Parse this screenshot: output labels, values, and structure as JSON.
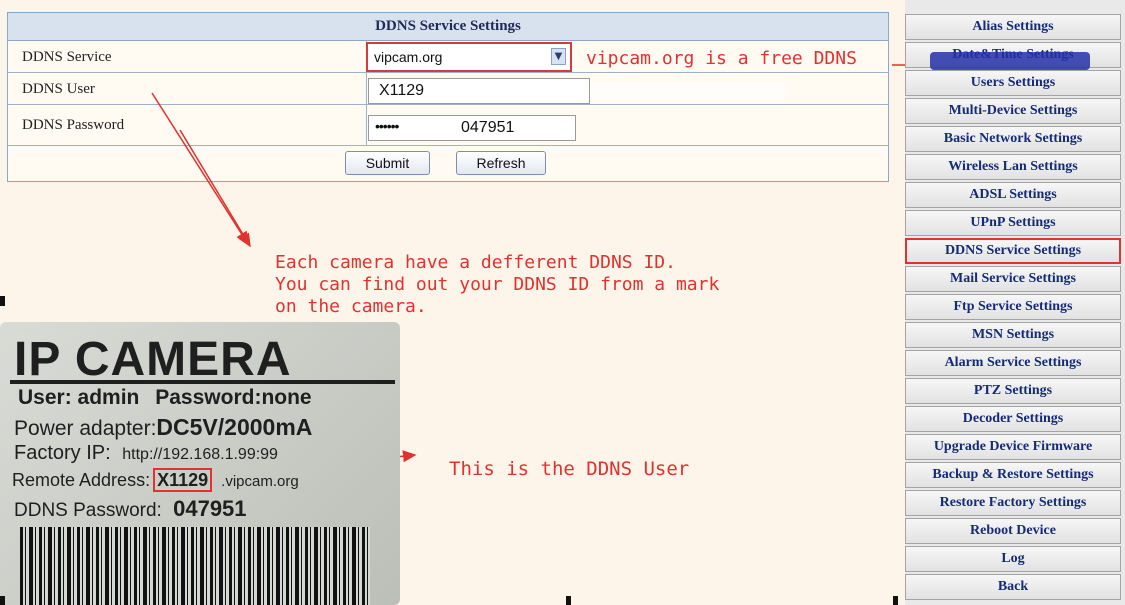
{
  "form": {
    "title": "DDNS Service Settings",
    "rows": [
      {
        "label": "DDNS Service"
      },
      {
        "label": "DDNS User"
      },
      {
        "label": "DDNS Password"
      }
    ],
    "service_value": "vipcam.org",
    "user_value": "X1129",
    "password_mask": "••••••",
    "password_value": "047951",
    "submit_label": "Submit",
    "refresh_label": "Refresh"
  },
  "annotations": {
    "service_note": "vipcam.org is a free DDNS",
    "id_note": "Each camera have a defferent DDNS ID.\nYou can find out your DDNS ID from a mark\non the camera.",
    "user_note": "This is the DDNS User"
  },
  "sticker": {
    "title": "IP CAMERA",
    "user_label": "User:",
    "user_value": "admin",
    "password_label": "Password:",
    "password_value": "none",
    "power_label": "Power adapter:",
    "power_value": "DC5V/2000mA",
    "factory_label": "Factory IP:",
    "factory_value": "http://192.168.1.99:99",
    "remote_label": "Remote Address:",
    "remote_id": "X1129",
    "remote_domain": ".vipcam.org",
    "ddns_password_label": "DDNS Password:",
    "ddns_password_value": "047951"
  },
  "sidebar": {
    "items": [
      {
        "label": "Alias Settings"
      },
      {
        "label": "Date&Time Settings"
      },
      {
        "label": "Users Settings"
      },
      {
        "label": "Multi-Device Settings"
      },
      {
        "label": "Basic Network Settings"
      },
      {
        "label": "Wireless Lan Settings"
      },
      {
        "label": "ADSL Settings"
      },
      {
        "label": "UPnP Settings"
      },
      {
        "label": "DDNS Service Settings",
        "active": true
      },
      {
        "label": "Mail Service Settings"
      },
      {
        "label": "Ftp Service Settings"
      },
      {
        "label": "MSN Settings"
      },
      {
        "label": "Alarm Service Settings"
      },
      {
        "label": "PTZ Settings"
      },
      {
        "label": "Decoder Settings"
      },
      {
        "label": "Upgrade Device Firmware"
      },
      {
        "label": "Backup & Restore Settings"
      },
      {
        "label": "Restore Factory Settings"
      },
      {
        "label": "Reboot Device"
      },
      {
        "label": "Log"
      },
      {
        "label": "Back"
      }
    ]
  },
  "colors": {
    "annotation_red": "#e0322e",
    "nav_text": "#152b78",
    "panel_header": "#d8e2ee",
    "background": "#fdf5ea"
  }
}
